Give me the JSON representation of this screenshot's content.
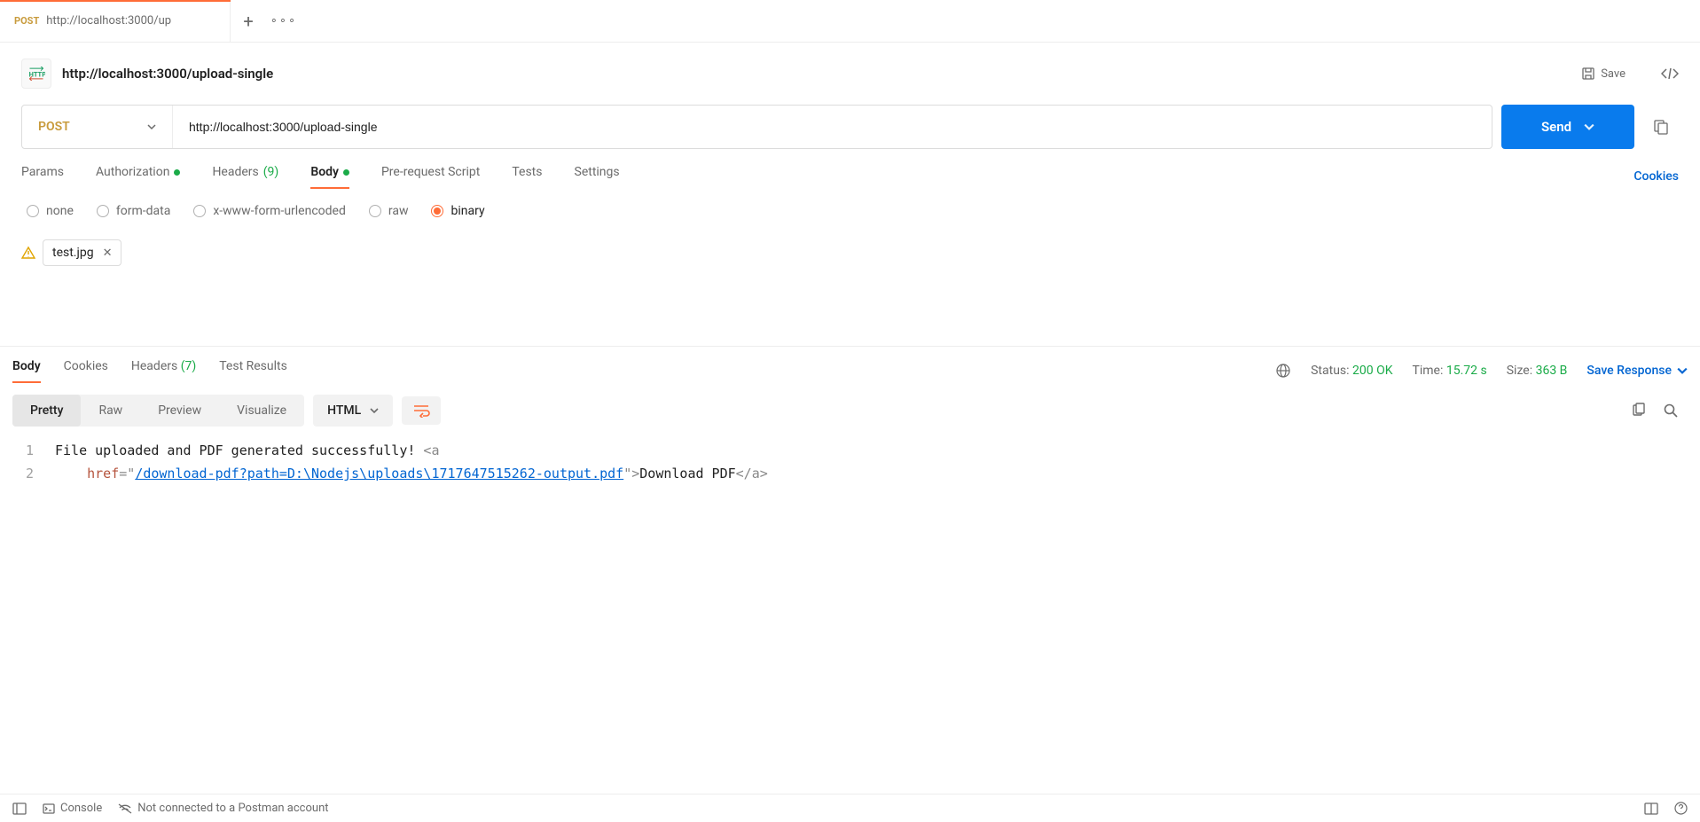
{
  "tab": {
    "method": "POST",
    "title": "http://localhost:3000/up"
  },
  "header": {
    "title": "http://localhost:3000/upload-single",
    "save": "Save"
  },
  "request": {
    "method": "POST",
    "url": "http://localhost:3000/upload-single",
    "send": "Send"
  },
  "reqTabs": {
    "params": "Params",
    "auth": "Authorization",
    "headers": "Headers",
    "headers_count": "(9)",
    "body": "Body",
    "prs": "Pre-request Script",
    "tests": "Tests",
    "settings": "Settings",
    "cookies": "Cookies"
  },
  "bodyTypes": {
    "none": "none",
    "form": "form-data",
    "xwww": "x-www-form-urlencoded",
    "raw": "raw",
    "binary": "binary"
  },
  "file": {
    "name": "test.jpg"
  },
  "respTabs": {
    "body": "Body",
    "cookies": "Cookies",
    "headers": "Headers",
    "headers_count": "(7)",
    "tests": "Test Results"
  },
  "respMeta": {
    "status_lbl": "Status:",
    "status_val": "200 OK",
    "time_lbl": "Time:",
    "time_val": "15.72 s",
    "size_lbl": "Size:",
    "size_val": "363 B",
    "save": "Save Response"
  },
  "viewTabs": {
    "pretty": "Pretty",
    "raw": "Raw",
    "preview": "Preview",
    "visualize": "Visualize",
    "lang": "HTML"
  },
  "responseBody": {
    "line1_text": "File uploaded and PDF generated successfully! ",
    "line1_tag_open": "<",
    "line1_tag_a": "a",
    "line2_attr": "href",
    "line2_eq": "=",
    "line2_q": "\"",
    "line2_url": "/download-pdf?path=D:\\Nodejs\\uploads\\1717647515262-output.pdf",
    "line2_gt": ">",
    "line2_text": "Download PDF",
    "line2_close_open": "</",
    "line2_close_a": "a",
    "line2_close_gt": ">"
  },
  "footer": {
    "console": "Console",
    "conn": "Not connected to a Postman account"
  }
}
